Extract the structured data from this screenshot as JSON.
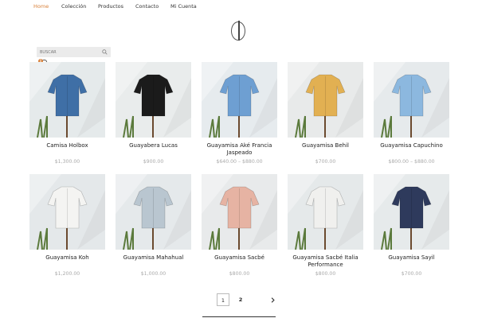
{
  "nav": {
    "items": [
      {
        "label": "Home",
        "active": true
      },
      {
        "label": "Colección",
        "active": false
      },
      {
        "label": "Productos",
        "active": false
      },
      {
        "label": "Contacto",
        "active": false
      },
      {
        "label": "Mi Cuenta",
        "active": false
      }
    ]
  },
  "colors": {
    "accent": "#d9813a",
    "price": "#aaaaaa",
    "search_bg": "#ebebeb"
  },
  "search": {
    "placeholder": "BUSCAR"
  },
  "cart": {
    "count": "0"
  },
  "products": [
    {
      "name": "Camisa Holbox",
      "price": "$1,300.00",
      "shirt_color": "#3f6fa6",
      "bg": "#e5eaeb"
    },
    {
      "name": "Guayabera Lucas",
      "price": "$900.00",
      "shirt_color": "#1b1b1b",
      "bg": "#e9ecec"
    },
    {
      "name": "Guayamisa Aké Francia Jaspeado",
      "price": "$640.00 – $880.00",
      "shirt_color": "#6e9fd2",
      "bg": "#e6ebee"
    },
    {
      "name": "Guayamisa Behil",
      "price": "$700.00",
      "shirt_color": "#e2b052",
      "bg": "#e8eaea"
    },
    {
      "name": "Guayamisa Capuchino",
      "price": "$800.00 – $880.00",
      "shirt_color": "#8cb8df",
      "bg": "#e6eaec"
    },
    {
      "name": "Guayamisa Koh",
      "price": "$1,200.00",
      "shirt_color": "#f4f4f2",
      "bg": "#e4e8ea"
    },
    {
      "name": "Guayamisa Mahahual",
      "price": "$1,000.00",
      "shirt_color": "#b9c6d0",
      "bg": "#e5e9eb"
    },
    {
      "name": "Guayamisa Sacbé",
      "price": "$800.00",
      "shirt_color": "#e6b3a3",
      "bg": "#e8eaeb"
    },
    {
      "name": "Guayamisa Sacbé Italia Performance",
      "price": "$800.00",
      "shirt_color": "#f0f0ee",
      "bg": "#e5e9ea"
    },
    {
      "name": "Guayamisa Sayil",
      "price": "$700.00",
      "shirt_color": "#2e3a5c",
      "bg": "#e6eaeb"
    }
  ],
  "pagination": {
    "current": "1",
    "next": "2",
    "next_icon": "chevron-right-icon"
  }
}
